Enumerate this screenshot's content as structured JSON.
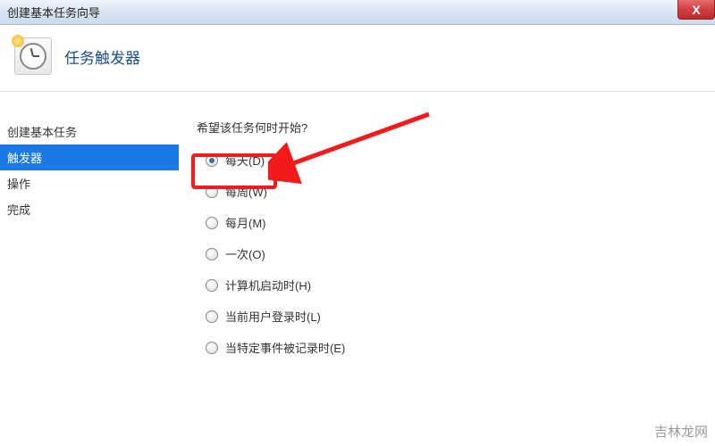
{
  "titlebar": {
    "text": "创建基本任务向导"
  },
  "header": {
    "title": "任务触发器"
  },
  "sidebar": {
    "items": [
      {
        "label": "创建基本任务",
        "selected": false
      },
      {
        "label": "触发器",
        "selected": true
      },
      {
        "label": "操作",
        "selected": false
      },
      {
        "label": "完成",
        "selected": false
      }
    ]
  },
  "main": {
    "question": "希望该任务何时开始?",
    "options": [
      {
        "label": "每天(D)",
        "checked": true
      },
      {
        "label": "每周(W)",
        "checked": false
      },
      {
        "label": "每月(M)",
        "checked": false
      },
      {
        "label": "一次(O)",
        "checked": false
      },
      {
        "label": "计算机启动时(H)",
        "checked": false
      },
      {
        "label": "当前用户登录时(L)",
        "checked": false
      },
      {
        "label": "当特定事件被记录时(E)",
        "checked": false
      }
    ]
  },
  "watermark": "吉林龙网"
}
